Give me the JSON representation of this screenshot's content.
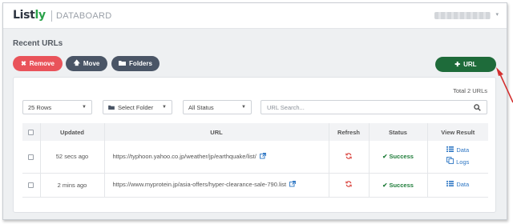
{
  "header": {
    "logo_text": "List",
    "logo_accent": "ly",
    "app_name": "DATABOARD"
  },
  "page": {
    "title": "Recent URLs"
  },
  "toolbar": {
    "remove_label": "Remove",
    "move_label": "Move",
    "folders_label": "Folders",
    "add_url_label": "URL"
  },
  "filters": {
    "total_label": "Total 2 URLs",
    "rows_value": "25 Rows",
    "folder_value": "Select Folder",
    "status_value": "All Status",
    "search_placeholder": "URL Search..."
  },
  "table": {
    "headers": [
      "Updated",
      "URL",
      "Refresh",
      "Status",
      "View Result"
    ],
    "rows": [
      {
        "updated": "52 secs ago",
        "url": "https://typhoon.yahoo.co.jp/weather/jp/earthquake/list/",
        "status": "Success",
        "data_label": "Data",
        "logs_label": "Logs"
      },
      {
        "updated": "2 mins ago",
        "url": "https://www.myprotein.jp/asia-offers/hyper-clearance-sale-790.list",
        "status": "Success",
        "data_label": "Data"
      }
    ]
  },
  "colors": {
    "remove": "#e9535a",
    "dark_button": "#4a5566",
    "add_url": "#1e6b3a",
    "success": "#1f7d3a",
    "link": "#2f77c4",
    "refresh": "#d9403a",
    "annotation_arrow": "#d32f2f"
  },
  "icons": {
    "remove": "times-icon",
    "move": "arrow-up-icon",
    "folders": "folder-icon",
    "add_url": "plus-icon",
    "search": "search-icon",
    "refresh": "refresh-icon",
    "status": "check-icon",
    "data": "list-icon",
    "logs": "copy-icon",
    "external": "external-link-icon"
  }
}
